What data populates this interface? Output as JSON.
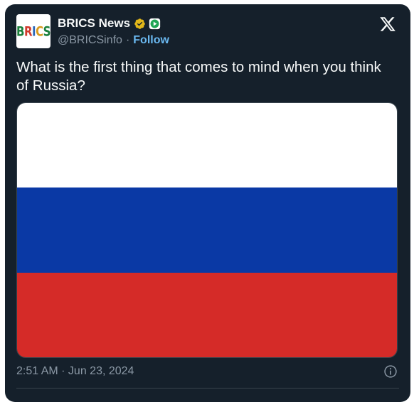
{
  "author": {
    "avatar_text": "BRICS",
    "display_name": "BRICS News",
    "handle": "@BRICSinfo",
    "separator": "·",
    "follow_label": "Follow"
  },
  "tweet": {
    "text": "What is the first thing that comes to mind when you think of Russia?",
    "timestamp": "2:51 AM · Jun 23, 2024"
  },
  "media": {
    "flag_colors": [
      "#ffffff",
      "#0a39a5",
      "#d52b28"
    ]
  },
  "icons": {
    "verified": "verified-badge-icon",
    "affiliation": "affiliate-badge-icon",
    "logo": "x-logo-icon",
    "info": "info-icon"
  },
  "colors": {
    "background": "#15202b",
    "text": "#f7f9f9",
    "secondary": "#8b98a5",
    "link": "#6ab8f0",
    "verified": "#e2b719",
    "affiliate": "#1fa655"
  }
}
